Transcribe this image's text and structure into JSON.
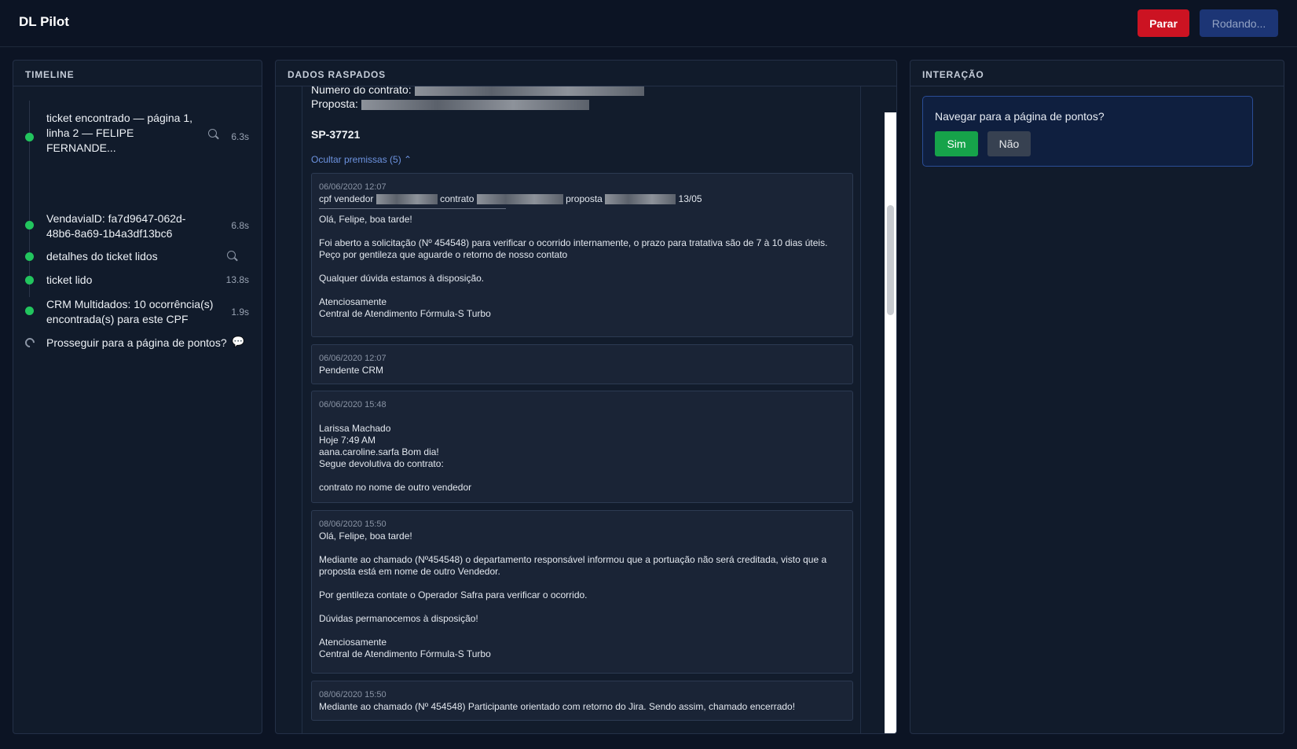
{
  "app": {
    "title": "DL Pilot"
  },
  "header": {
    "stop_label": "Parar",
    "running_label": "Rodando..."
  },
  "timeline": {
    "title": "TIMELINE",
    "items": [
      {
        "text": "ticket encontrado — página 1, linha 2 — FELIPE FERNANDE...",
        "time": "6.3s",
        "status": "done",
        "icon": "search-icon"
      },
      {
        "text": "VendavialD: fa7d9647-062d-48b6-8a69-1b4a3df13bc6",
        "time": "6.8s",
        "status": "done"
      },
      {
        "text": "detalhes do ticket lidos",
        "time": "",
        "status": "done",
        "icon": "search-icon"
      },
      {
        "text": "ticket lido",
        "time": "13.8s",
        "status": "done"
      },
      {
        "text": "CRM Multidados: 10 ocorrência(s) encontrada(s) para este CPF",
        "time": "1.9s",
        "status": "done"
      },
      {
        "text": "Prosseguir para a página de pontos?",
        "time": "",
        "status": "pending",
        "icon": "chat-bubble-icon",
        "icon_glyph": "💬"
      }
    ]
  },
  "scraped": {
    "title": "DADOS RASPADOS",
    "contract_label": "Numero do contrato:",
    "proposal_label": "Proposta:",
    "code": "SP-37721",
    "hide_link": "Ocultar premissas (5) ⌃",
    "messages": [
      {
        "date": "06/06/2020 12:07",
        "header": {
          "seller_label": "cpf vendedor",
          "contract_label": "contrato",
          "proposal_label": "proposta",
          "date_suffix": "13/05"
        },
        "body": "Olá, Felipe, boa tarde!\n\nFoi aberto a solicitação (Nº 454548) para verificar o ocorrido internamente, o prazo para tratativa são de 7 à 10 dias úteis. Peço por gentileza que aguarde o retorno de nosso contato\n\nQualquer dúvida estamos à disposição.\n\nAtenciosamente\nCentral de Atendimento Fórmula-S Turbo"
      },
      {
        "date": "06/06/2020 12:07",
        "body": "Pendente CRM"
      },
      {
        "date": "06/06/2020 15:48",
        "body": "\nLarissa Machado\nHoje 7:49 AM\naana.caroline.sarfa Bom dia!\nSegue devolutiva do contrato:\n\ncontrato no nome de outro vendedor"
      },
      {
        "date": "08/06/2020 15:50",
        "body": "Olá, Felipe, boa tarde!\n\nMediante ao chamado (Nº454548) o departamento responsável informou que a portuação não será creditada, visto que a proposta está em nome de outro Vendedor.\n\nPor gentileza contate o Operador Safra para verificar o ocorrido.\n\nDúvidas permanocemos à disposição!\n\nAtenciosamente\nCentral de Atendimento Fórmula-S Turbo"
      },
      {
        "date": "08/06/2020 15:50",
        "body": "Mediante ao chamado (Nº 454548) Participante orientado com retorno do Jira. Sendo assim, chamado encerrado!"
      }
    ]
  },
  "interaction": {
    "title": "INTERAÇÃO",
    "question": "Navegar para a página de pontos?",
    "yes_label": "Sim",
    "no_label": "Não"
  },
  "colors": {
    "background": "#0c1424",
    "stop": "#cc1322",
    "running": "#1c3575",
    "success": "#22c55e",
    "link": "#6d93e0"
  }
}
